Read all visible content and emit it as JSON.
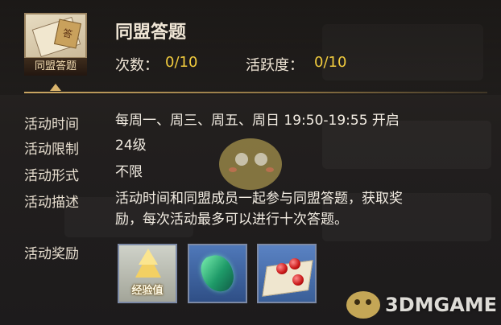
{
  "activity": {
    "icon_name": "scroll-quiz-icon",
    "icon_banner_label": "同盟答题",
    "icon_seal_char": "答",
    "title": "同盟答题",
    "stats": {
      "count_label": "次数：",
      "count_value": "0/10",
      "activity_label": "活跃度：",
      "activity_value": "0/10"
    }
  },
  "details": [
    {
      "label": "活动时间",
      "value": "每周一、周三、周五、周日 19:50-19:55 开启"
    },
    {
      "label": "活动限制",
      "value": "24级"
    },
    {
      "label": "活动形式",
      "value": "不限"
    },
    {
      "label": "活动描述",
      "value_line1": "活动时间和同盟成员一起参与同盟答题，获取奖",
      "value_line2": "励，每次活动最多可以进行十次答题。"
    },
    {
      "label": "活动奖励"
    }
  ],
  "rewards": [
    {
      "icon": "experience-icon",
      "label": "经验值"
    },
    {
      "icon": "green-gem-icon"
    },
    {
      "icon": "red-beads-cloth-icon"
    }
  ],
  "watermark": {
    "text": "3DMGAME",
    "icon": "mascot-bird-icon"
  },
  "colors": {
    "accent_gold": "#f2cc3e",
    "divider_gold": "#caa662",
    "text_light": "#f0e6d6",
    "panel_bg": "#221f1e"
  }
}
